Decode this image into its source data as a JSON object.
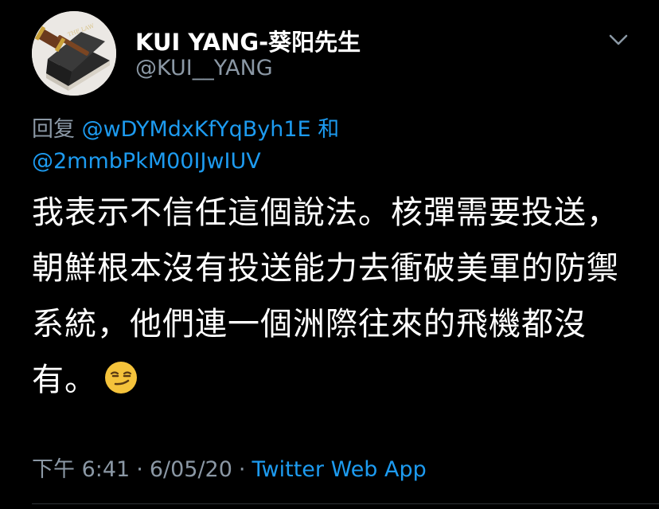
{
  "tweet": {
    "author": {
      "display_name": "KUI YANG-葵阳先生",
      "handle": "@KUI__YANG",
      "avatar_icon": "law-book-gavel-avatar",
      "avatar_text": "THE LAW"
    },
    "menu_icon": "chevron-down-icon",
    "reply": {
      "prefix": "回复",
      "mention_1": "@wDYMdxKfYqByh1E",
      "connector": "和",
      "mention_2": "@2mmbPkM00IJwIUV"
    },
    "text": "我表示不信任這個說法。核彈需要投送，朝鮮根本沒有投送能力去衝破美軍的防禦系統，他們連一個洲際往來的飛機都沒有。",
    "emoji": "smirking-face-emoji",
    "meta": {
      "time": "下午 6:41",
      "date": "6/05/20",
      "source": "Twitter Web App",
      "separator": "·"
    }
  },
  "colors": {
    "background": "#000000",
    "text": "#ffffff",
    "secondary": "#8b98a5",
    "link": "#1d9bf0"
  }
}
